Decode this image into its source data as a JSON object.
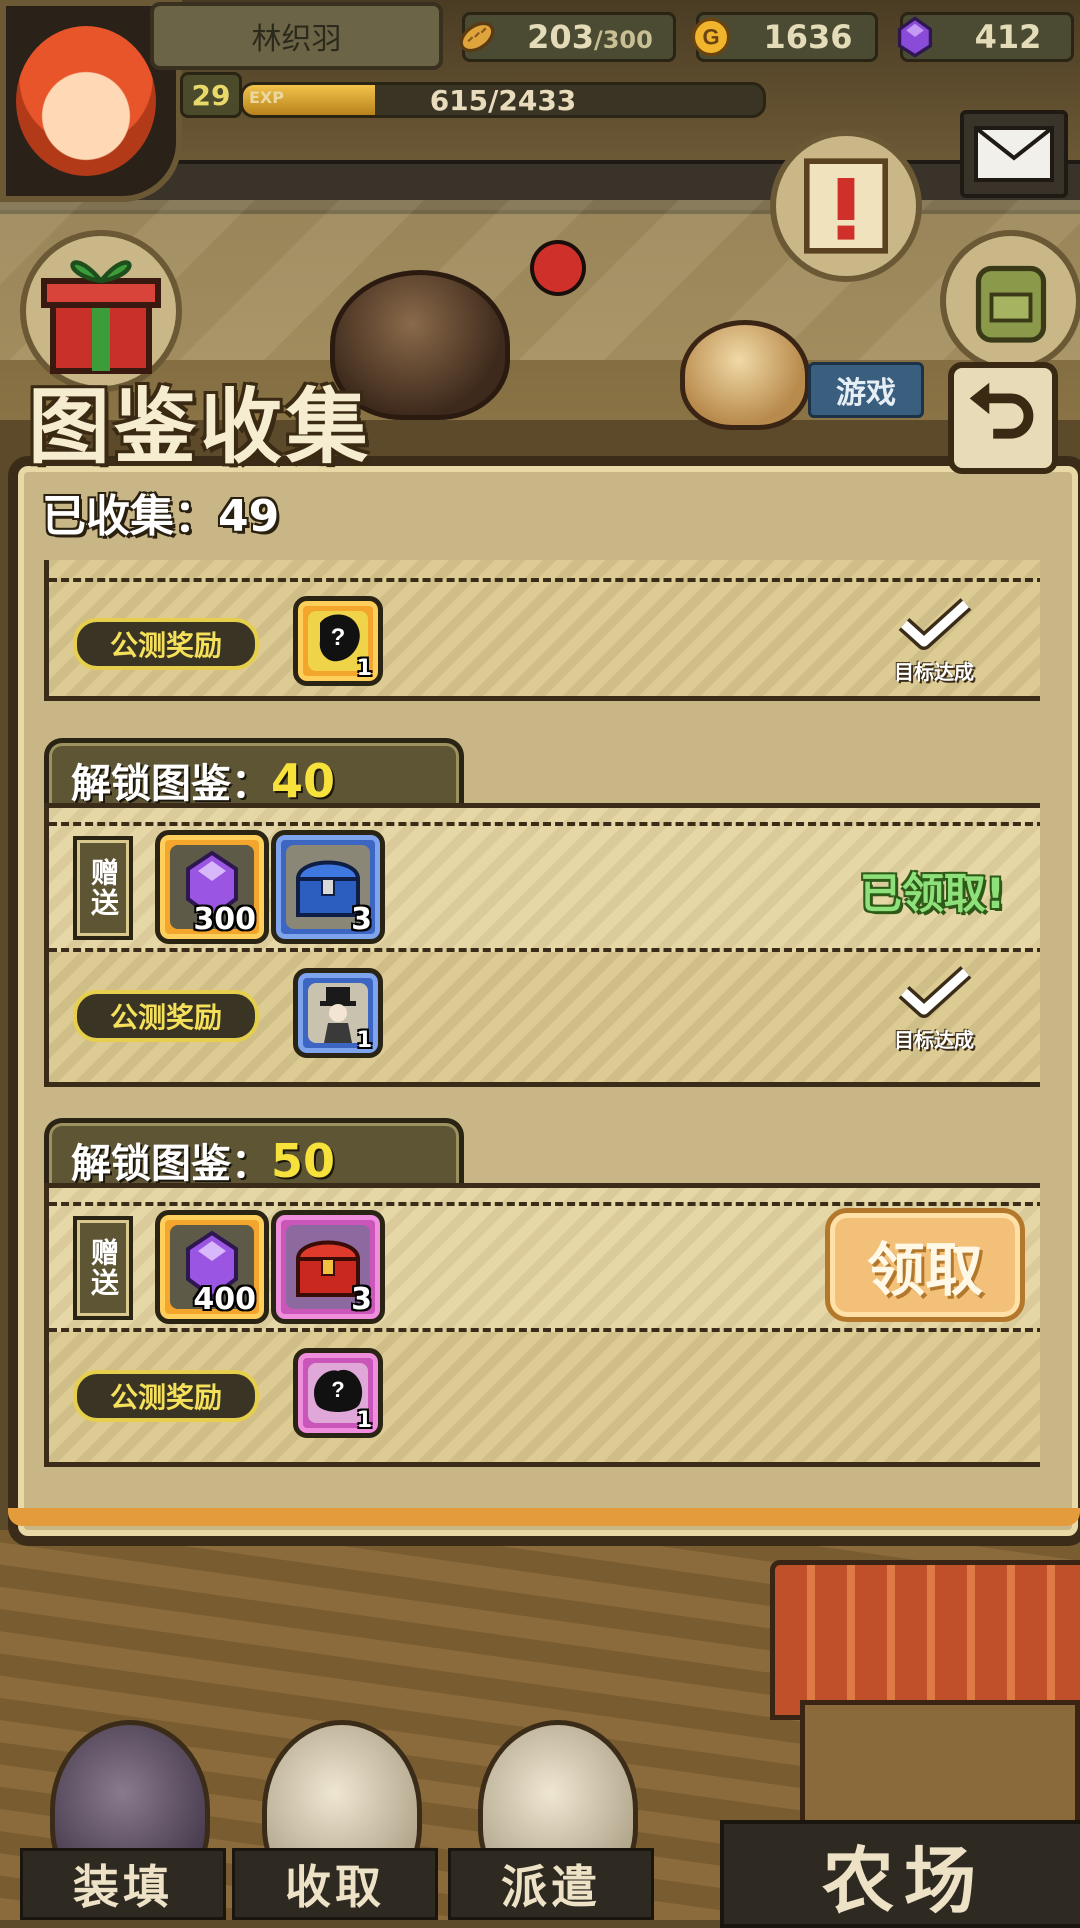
{
  "hud": {
    "player_name": "林织羽",
    "level": "29",
    "exp_label": "EXP",
    "exp_text": "615/2433",
    "exp_fraction": 0.253,
    "bread_value": "203",
    "bread_max": "/300",
    "gold_value": "1636",
    "gem_value": "412",
    "game_tag": "游戏"
  },
  "panel": {
    "title": "图鉴收集",
    "collected_label": "已收集：49"
  },
  "tiers": [
    {
      "reward_tag": "公测奖励",
      "reward_item": {
        "icon": "mystery-character-icon",
        "count": "1",
        "frame": "orange"
      },
      "status": "目标达成"
    },
    {
      "label": "解锁图鉴：",
      "number": "40",
      "gift_tag": "赠送",
      "items": [
        {
          "icon": "purple-gem-icon",
          "count": "300",
          "frame": "orange"
        },
        {
          "icon": "blue-chest-icon",
          "count": "3",
          "frame": "blue"
        }
      ],
      "gift_status": "已领取!",
      "reward_tag": "公测奖励",
      "reward_item": {
        "icon": "top-hat-character-icon",
        "count": "1",
        "frame": "blue"
      },
      "status": "目标达成"
    },
    {
      "label": "解锁图鉴：",
      "number": "50",
      "gift_tag": "赠送",
      "items": [
        {
          "icon": "purple-gem-icon",
          "count": "400",
          "frame": "orange"
        },
        {
          "icon": "red-chest-icon",
          "count": "3",
          "frame": "pink"
        }
      ],
      "claim_label": "领取",
      "reward_tag": "公测奖励",
      "reward_item": {
        "icon": "mystery-creature-icon",
        "count": "1",
        "frame": "pink"
      }
    }
  ],
  "nav": {
    "load_label": "装填",
    "collect_label": "收取",
    "dispatch_label": "派遣",
    "farm_label": "农场"
  },
  "colors": {
    "panel_bg": "#c9b687",
    "accent_orange": "#f3a52c",
    "claimed_green": "#8ee17a",
    "tier_number_yellow": "#f6e23a"
  }
}
